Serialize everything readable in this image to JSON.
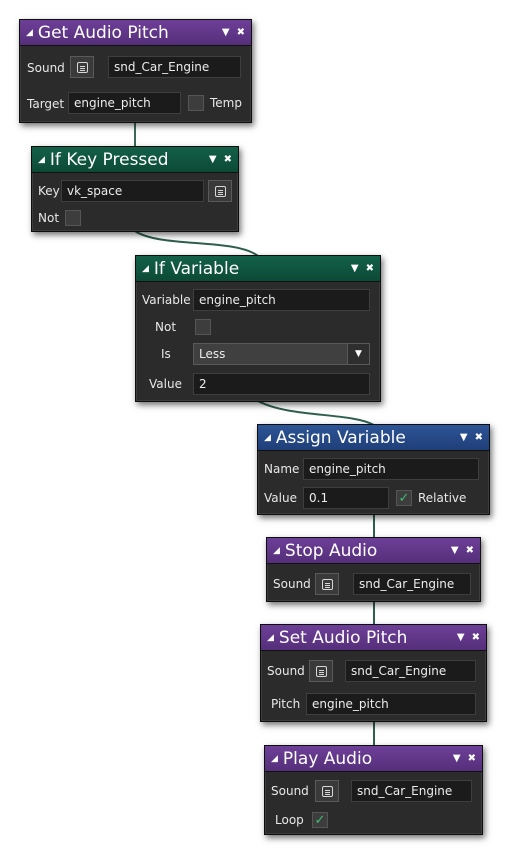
{
  "nodes": {
    "get_audio_pitch": {
      "title": "Get Audio Pitch",
      "sound_label": "Sound",
      "sound_value": "snd_Car_Engine",
      "target_label": "Target",
      "target_value": "engine_pitch",
      "temp_label": "Temp",
      "temp_checked": false
    },
    "if_key_pressed": {
      "title": "If Key Pressed",
      "key_label": "Key",
      "key_value": "vk_space",
      "not_label": "Not",
      "not_checked": false
    },
    "if_variable": {
      "title": "If Variable",
      "variable_label": "Variable",
      "variable_value": "engine_pitch",
      "not_label": "Not",
      "not_checked": false,
      "is_label": "Is",
      "is_value": "Less",
      "value_label": "Value",
      "value_value": "2"
    },
    "assign_variable": {
      "title": "Assign Variable",
      "name_label": "Name",
      "name_value": "engine_pitch",
      "value_label": "Value",
      "value_value": "0.1",
      "relative_label": "Relative",
      "relative_checked": true
    },
    "stop_audio": {
      "title": "Stop Audio",
      "sound_label": "Sound",
      "sound_value": "snd_Car_Engine"
    },
    "set_audio_pitch": {
      "title": "Set Audio Pitch",
      "sound_label": "Sound",
      "sound_value": "snd_Car_Engine",
      "pitch_label": "Pitch",
      "pitch_value": "engine_pitch"
    },
    "play_audio": {
      "title": "Play Audio",
      "sound_label": "Sound",
      "sound_value": "snd_Car_Engine",
      "loop_label": "Loop",
      "loop_checked": true
    }
  },
  "icons": {
    "collapse": "collapse-triangle-icon",
    "menu": "dropdown-arrow-icon",
    "close": "close-icon",
    "asset_picker": "asset-list-icon",
    "checkmark": "checkmark-icon"
  },
  "colors": {
    "purple_header": "#5f3688",
    "green_header": "#10543f",
    "blue_header": "#264a88",
    "node_body": "#2b2b2b",
    "wire": "#2f5f4d",
    "check": "#3fbf6f"
  }
}
